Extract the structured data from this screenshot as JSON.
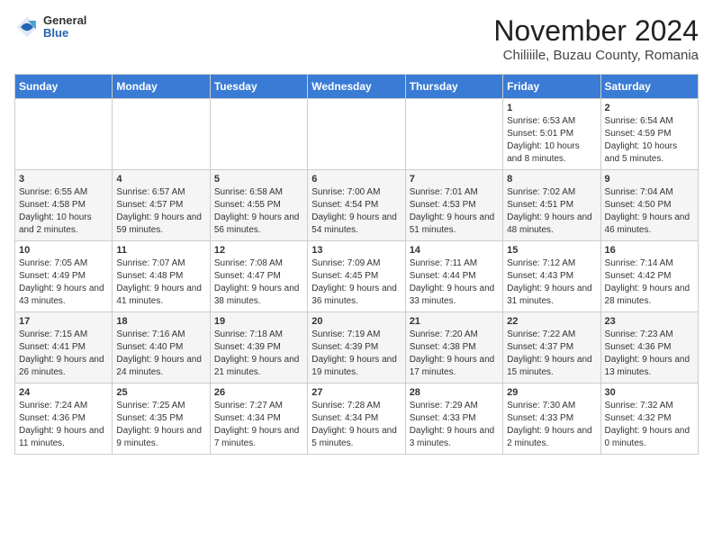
{
  "logo": {
    "general": "General",
    "blue": "Blue"
  },
  "title": "November 2024",
  "subtitle": "Chiliiile, Buzau County, Romania",
  "weekdays": [
    "Sunday",
    "Monday",
    "Tuesday",
    "Wednesday",
    "Thursday",
    "Friday",
    "Saturday"
  ],
  "weeks": [
    [
      {
        "day": "",
        "info": ""
      },
      {
        "day": "",
        "info": ""
      },
      {
        "day": "",
        "info": ""
      },
      {
        "day": "",
        "info": ""
      },
      {
        "day": "",
        "info": ""
      },
      {
        "day": "1",
        "info": "Sunrise: 6:53 AM\nSunset: 5:01 PM\nDaylight: 10 hours and 8 minutes."
      },
      {
        "day": "2",
        "info": "Sunrise: 6:54 AM\nSunset: 4:59 PM\nDaylight: 10 hours and 5 minutes."
      }
    ],
    [
      {
        "day": "3",
        "info": "Sunrise: 6:55 AM\nSunset: 4:58 PM\nDaylight: 10 hours and 2 minutes."
      },
      {
        "day": "4",
        "info": "Sunrise: 6:57 AM\nSunset: 4:57 PM\nDaylight: 9 hours and 59 minutes."
      },
      {
        "day": "5",
        "info": "Sunrise: 6:58 AM\nSunset: 4:55 PM\nDaylight: 9 hours and 56 minutes."
      },
      {
        "day": "6",
        "info": "Sunrise: 7:00 AM\nSunset: 4:54 PM\nDaylight: 9 hours and 54 minutes."
      },
      {
        "day": "7",
        "info": "Sunrise: 7:01 AM\nSunset: 4:53 PM\nDaylight: 9 hours and 51 minutes."
      },
      {
        "day": "8",
        "info": "Sunrise: 7:02 AM\nSunset: 4:51 PM\nDaylight: 9 hours and 48 minutes."
      },
      {
        "day": "9",
        "info": "Sunrise: 7:04 AM\nSunset: 4:50 PM\nDaylight: 9 hours and 46 minutes."
      }
    ],
    [
      {
        "day": "10",
        "info": "Sunrise: 7:05 AM\nSunset: 4:49 PM\nDaylight: 9 hours and 43 minutes."
      },
      {
        "day": "11",
        "info": "Sunrise: 7:07 AM\nSunset: 4:48 PM\nDaylight: 9 hours and 41 minutes."
      },
      {
        "day": "12",
        "info": "Sunrise: 7:08 AM\nSunset: 4:47 PM\nDaylight: 9 hours and 38 minutes."
      },
      {
        "day": "13",
        "info": "Sunrise: 7:09 AM\nSunset: 4:45 PM\nDaylight: 9 hours and 36 minutes."
      },
      {
        "day": "14",
        "info": "Sunrise: 7:11 AM\nSunset: 4:44 PM\nDaylight: 9 hours and 33 minutes."
      },
      {
        "day": "15",
        "info": "Sunrise: 7:12 AM\nSunset: 4:43 PM\nDaylight: 9 hours and 31 minutes."
      },
      {
        "day": "16",
        "info": "Sunrise: 7:14 AM\nSunset: 4:42 PM\nDaylight: 9 hours and 28 minutes."
      }
    ],
    [
      {
        "day": "17",
        "info": "Sunrise: 7:15 AM\nSunset: 4:41 PM\nDaylight: 9 hours and 26 minutes."
      },
      {
        "day": "18",
        "info": "Sunrise: 7:16 AM\nSunset: 4:40 PM\nDaylight: 9 hours and 24 minutes."
      },
      {
        "day": "19",
        "info": "Sunrise: 7:18 AM\nSunset: 4:39 PM\nDaylight: 9 hours and 21 minutes."
      },
      {
        "day": "20",
        "info": "Sunrise: 7:19 AM\nSunset: 4:39 PM\nDaylight: 9 hours and 19 minutes."
      },
      {
        "day": "21",
        "info": "Sunrise: 7:20 AM\nSunset: 4:38 PM\nDaylight: 9 hours and 17 minutes."
      },
      {
        "day": "22",
        "info": "Sunrise: 7:22 AM\nSunset: 4:37 PM\nDaylight: 9 hours and 15 minutes."
      },
      {
        "day": "23",
        "info": "Sunrise: 7:23 AM\nSunset: 4:36 PM\nDaylight: 9 hours and 13 minutes."
      }
    ],
    [
      {
        "day": "24",
        "info": "Sunrise: 7:24 AM\nSunset: 4:36 PM\nDaylight: 9 hours and 11 minutes."
      },
      {
        "day": "25",
        "info": "Sunrise: 7:25 AM\nSunset: 4:35 PM\nDaylight: 9 hours and 9 minutes."
      },
      {
        "day": "26",
        "info": "Sunrise: 7:27 AM\nSunset: 4:34 PM\nDaylight: 9 hours and 7 minutes."
      },
      {
        "day": "27",
        "info": "Sunrise: 7:28 AM\nSunset: 4:34 PM\nDaylight: 9 hours and 5 minutes."
      },
      {
        "day": "28",
        "info": "Sunrise: 7:29 AM\nSunset: 4:33 PM\nDaylight: 9 hours and 3 minutes."
      },
      {
        "day": "29",
        "info": "Sunrise: 7:30 AM\nSunset: 4:33 PM\nDaylight: 9 hours and 2 minutes."
      },
      {
        "day": "30",
        "info": "Sunrise: 7:32 AM\nSunset: 4:32 PM\nDaylight: 9 hours and 0 minutes."
      }
    ]
  ]
}
